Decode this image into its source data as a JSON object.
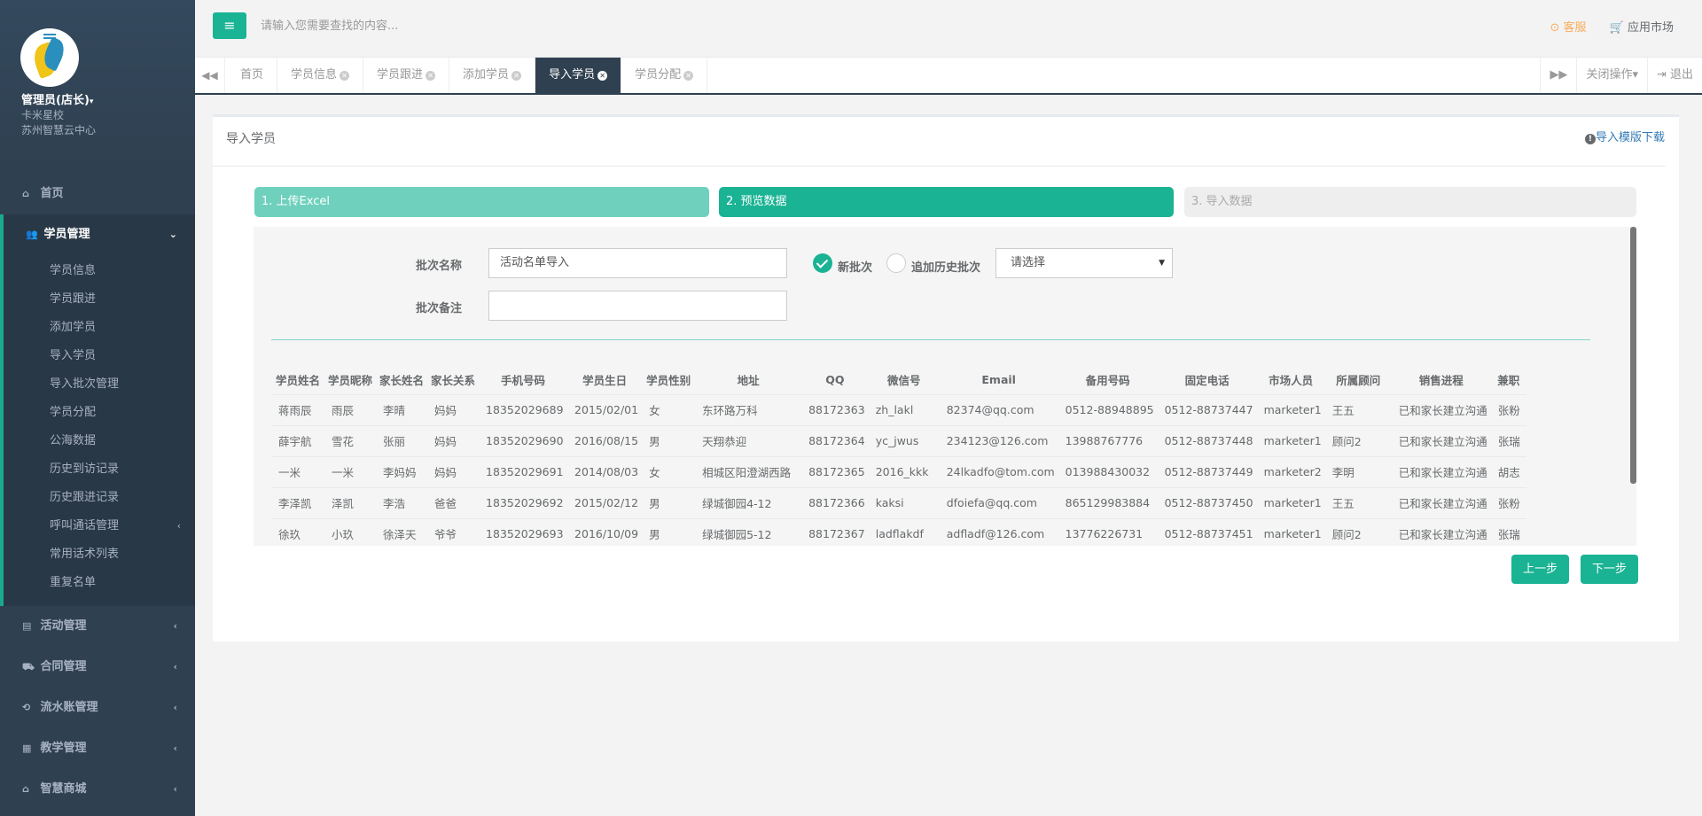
{
  "profile": {
    "user_name": "管理员(店长)",
    "caret": "▾",
    "school": "卡米星校",
    "center": "苏州智慧云中心"
  },
  "sidebar": {
    "items": [
      {
        "label": "首页",
        "icon": "home-icon"
      },
      {
        "label": "学员管理",
        "icon": "users-icon",
        "arrow": "⌄"
      },
      {
        "label": "活动管理",
        "icon": "map-icon",
        "arrow": "‹"
      },
      {
        "label": "合同管理",
        "icon": "cart-icon",
        "arrow": "‹"
      },
      {
        "label": "流水账管理",
        "icon": "retweet-icon",
        "arrow": "‹"
      },
      {
        "label": "教学管理",
        "icon": "calendar-icon",
        "arrow": "‹"
      },
      {
        "label": "智慧商城",
        "icon": "inbox-icon",
        "arrow": "‹"
      }
    ],
    "sub_items": [
      {
        "label": "学员信息"
      },
      {
        "label": "学员跟进"
      },
      {
        "label": "添加学员"
      },
      {
        "label": "导入学员"
      },
      {
        "label": "导入批次管理"
      },
      {
        "label": "学员分配"
      },
      {
        "label": "公海数据"
      },
      {
        "label": "历史到访记录"
      },
      {
        "label": "历史跟进记录"
      },
      {
        "label": "呼叫通话管理",
        "arrow": "‹"
      },
      {
        "label": "常用话术列表"
      },
      {
        "label": "重复名单"
      }
    ]
  },
  "topbar": {
    "menu_icon": "≡",
    "search_placeholder": "请输入您需要查找的内容...",
    "kefu_label": "⊙ 客服",
    "market_label": "🛒 应用市场"
  },
  "tabs": {
    "back_icon": "◀◀",
    "forward_icon": "▶▶",
    "items": [
      {
        "label": "首页",
        "closable": false
      },
      {
        "label": "学员信息",
        "closable": true
      },
      {
        "label": "学员跟进",
        "closable": true
      },
      {
        "label": "添加学员",
        "closable": true
      },
      {
        "label": "导入学员",
        "closable": true,
        "active": true
      },
      {
        "label": "学员分配",
        "closable": true
      }
    ],
    "close_ops": "关闭操作▾",
    "logout": "⇥ 退出"
  },
  "main": {
    "title": "导入学员",
    "template_download": "导入模版下载",
    "steps": [
      "1. 上传Excel",
      "2. 预览数据",
      "3. 导入数据"
    ],
    "batch_name_label": "批次名称",
    "batch_name_value": "活动名单导入",
    "batch_note_label": "批次备注",
    "batch_note_value": "",
    "radio_new": "新批次",
    "radio_append": "追加历史批次",
    "select_value": "请选择",
    "prev_button": "上一步",
    "next_button": "下一步"
  },
  "table": {
    "headers": [
      "学员姓名",
      "学员昵称",
      "家长姓名",
      "家长关系",
      "手机号码",
      "学员生日",
      "学员性别",
      "地址",
      "QQ",
      "微信号",
      "Email",
      "备用号码",
      "固定电话",
      "市场人员",
      "所属顾问",
      "销售进程",
      "兼职"
    ],
    "rows": [
      [
        "蒋雨辰",
        "雨辰",
        "李晴",
        "妈妈",
        "18352029689",
        "2015/02/01",
        "女",
        "东环路万科",
        "88172363",
        "zh_lakl",
        "82374@qq.com",
        "0512-88948895",
        "0512-88737447",
        "marketer1",
        "王五",
        "已和家长建立沟通",
        "张粉"
      ],
      [
        "薛宇航",
        "雪花",
        "张丽",
        "妈妈",
        "18352029690",
        "2016/08/15",
        "男",
        "天翔恭迎",
        "88172364",
        "yc_jwus",
        "234123@126.com",
        "13988767776",
        "0512-88737448",
        "marketer1",
        "顾问2",
        "已和家长建立沟通",
        "张瑞"
      ],
      [
        "一米",
        "一米",
        "李妈妈",
        "妈妈",
        "18352029691",
        "2014/08/03",
        "女",
        "相城区阳澄湖西路",
        "88172365",
        "2016_kkk",
        "24lkadfo@tom.com",
        "013988430032",
        "0512-88737449",
        "marketer2",
        "李明",
        "已和家长建立沟通",
        "胡志"
      ],
      [
        "李泽凯",
        "泽凯",
        "李浩",
        "爸爸",
        "18352029692",
        "2015/02/12",
        "男",
        "绿城御园4-12",
        "88172366",
        "kaksi",
        "dfoiefa@qq.com",
        "865129983884",
        "0512-88737450",
        "marketer1",
        "王五",
        "已和家长建立沟通",
        "张粉"
      ],
      [
        "徐玖",
        "小玖",
        "徐泽天",
        "爷爷",
        "18352029693",
        "2016/10/09",
        "男",
        "绿城御园5-12",
        "88172367",
        "ladflakdf",
        "adfladf@126.com",
        "13776226731",
        "0512-88737451",
        "marketer1",
        "顾问2",
        "已和家长建立沟通",
        "张瑞"
      ]
    ]
  }
}
